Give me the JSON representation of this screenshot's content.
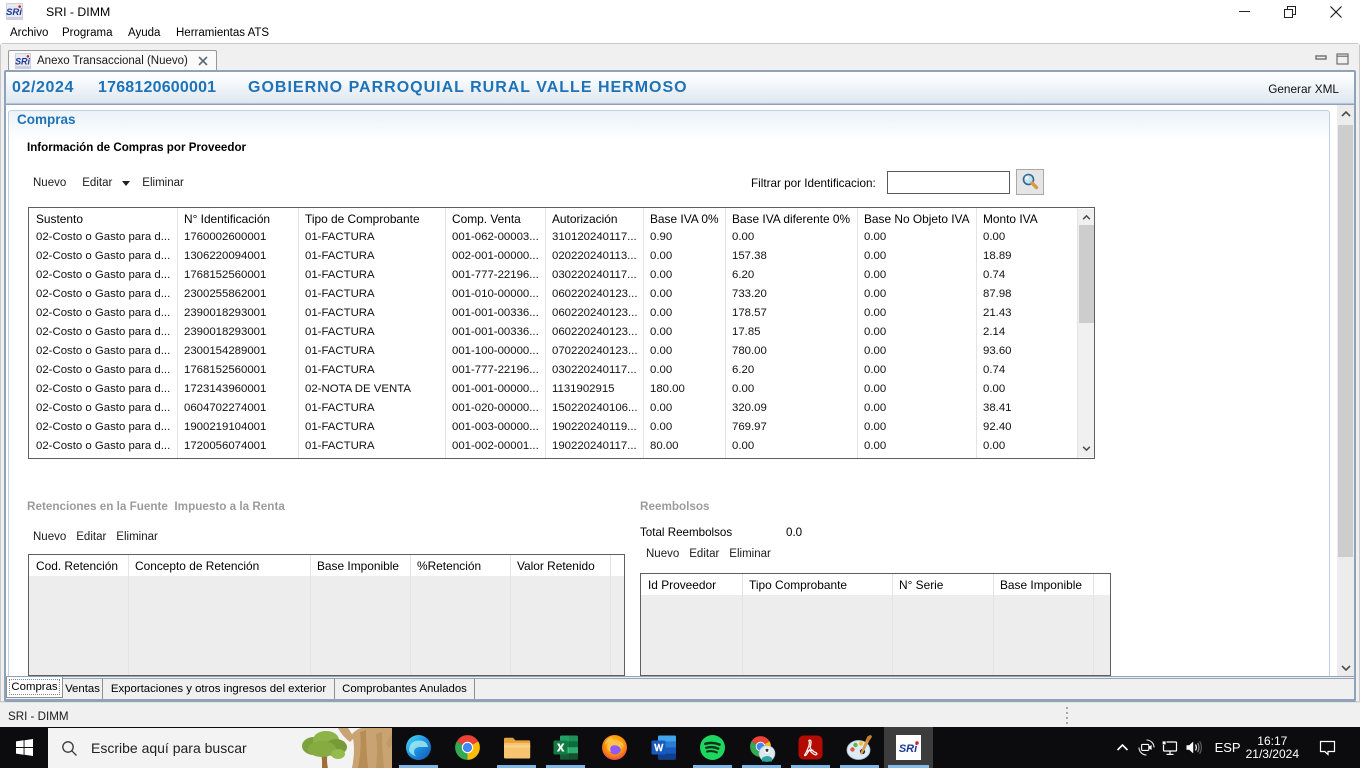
{
  "window": {
    "title": "SRI - DIMM",
    "controls": {
      "minimize": "minimize",
      "restore": "restore",
      "close": "close"
    }
  },
  "menu": {
    "items": [
      "Archivo",
      "Programa",
      "Ayuda",
      "Herramientas ATS"
    ]
  },
  "editor_tab": {
    "label": "Anexo Transaccional (Nuevo)",
    "icon": "sri-logo-icon",
    "close_icon": "close-tab-icon"
  },
  "doc_header": {
    "period": "02/2024",
    "ruc": "1768120600001",
    "taxpayer": "GOBIERNO PARROQUIAL RURAL VALLE HERMOSO",
    "action": "Generar XML"
  },
  "section": {
    "title": "Compras"
  },
  "compras": {
    "heading": "Información de Compras por Proveedor",
    "toolbar": {
      "nuevo": "Nuevo",
      "editar": "Editar",
      "eliminar": "Eliminar"
    },
    "filter": {
      "label": "Filtrar por Identificacion:",
      "value": "",
      "button_icon": "search-magnifier-icon"
    },
    "table": {
      "headers": [
        "Sustento",
        "N° Identificación",
        "Tipo de Comprobante",
        "Comp. Venta",
        "Autorización",
        "Base IVA 0%",
        "Base IVA diferente 0%",
        "Base No Objeto IVA",
        "Monto IVA"
      ],
      "rows": [
        [
          "02-Costo o Gasto para d...",
          "1760002600001",
          "01-FACTURA",
          "001-062-00003...",
          "310120240117...",
          "0.90",
          "0.00",
          "0.00",
          "0.00"
        ],
        [
          "02-Costo o Gasto para d...",
          "1306220094001",
          "01-FACTURA",
          "002-001-00000...",
          "020220240113...",
          "0.00",
          "157.38",
          "0.00",
          "18.89"
        ],
        [
          "02-Costo o Gasto para d...",
          "1768152560001",
          "01-FACTURA",
          "001-777-22196...",
          "030220240117...",
          "0.00",
          "6.20",
          "0.00",
          "0.74"
        ],
        [
          "02-Costo o Gasto para d...",
          "2300255862001",
          "01-FACTURA",
          "001-010-00000...",
          "060220240123...",
          "0.00",
          "733.20",
          "0.00",
          "87.98"
        ],
        [
          "02-Costo o Gasto para d...",
          "2390018293001",
          "01-FACTURA",
          "001-001-00336...",
          "060220240123...",
          "0.00",
          "178.57",
          "0.00",
          "21.43"
        ],
        [
          "02-Costo o Gasto para d...",
          "2390018293001",
          "01-FACTURA",
          "001-001-00336...",
          "060220240123...",
          "0.00",
          "17.85",
          "0.00",
          "2.14"
        ],
        [
          "02-Costo o Gasto para d...",
          "2300154289001",
          "01-FACTURA",
          "001-100-00000...",
          "070220240123...",
          "0.00",
          "780.00",
          "0.00",
          "93.60"
        ],
        [
          "02-Costo o Gasto para d...",
          "1768152560001",
          "01-FACTURA",
          "001-777-22196...",
          "030220240117...",
          "0.00",
          "6.20",
          "0.00",
          "0.74"
        ],
        [
          "02-Costo o Gasto para d...",
          "1723143960001",
          "02-NOTA DE VENTA",
          "001-001-00000...",
          "1131902915",
          "180.00",
          "0.00",
          "0.00",
          "0.00"
        ],
        [
          "02-Costo o Gasto para d...",
          "0604702274001",
          "01-FACTURA",
          "001-020-00000...",
          "150220240106...",
          "0.00",
          "320.09",
          "0.00",
          "38.41"
        ],
        [
          "02-Costo o Gasto para d...",
          "1900219104001",
          "01-FACTURA",
          "001-003-00000...",
          "190220240119...",
          "0.00",
          "769.97",
          "0.00",
          "92.40"
        ],
        [
          "02-Costo o Gasto para d...",
          "1720056074001",
          "01-FACTURA",
          "001-002-00001...",
          "190220240117...",
          "80.00",
          "0.00",
          "0.00",
          "0.00"
        ]
      ]
    }
  },
  "retenciones": {
    "title": "Retenciones en la Fuente  Impuesto a la Renta",
    "toolbar": {
      "nuevo": "Nuevo",
      "editar": "Editar",
      "eliminar": "Eliminar"
    },
    "table": {
      "headers": [
        "Cod. Retención",
        "Concepto de Retención",
        "Base Imponible",
        "%Retención",
        "Valor Retenido"
      ],
      "rows": []
    }
  },
  "reembolsos": {
    "title": "Reembolsos",
    "total_label": "Total Reembolsos",
    "total_value": "0.0",
    "toolbar": {
      "nuevo": "Nuevo",
      "editar": "Editar",
      "eliminar": "Eliminar"
    },
    "table": {
      "headers": [
        "Id Proveedor",
        "Tipo Comprobante",
        "N° Serie",
        "Base Imponible"
      ],
      "rows": []
    }
  },
  "bottom_tabs": {
    "items": [
      {
        "label": "Compras",
        "active": true
      },
      {
        "label": "Ventas",
        "active": false
      },
      {
        "label": "Exportaciones y otros ingresos del exterior",
        "active": false
      },
      {
        "label": "Comprobantes Anulados",
        "active": false
      }
    ]
  },
  "statusbar": {
    "text": "SRI - DIMM"
  },
  "taskbar": {
    "start_icon": "windows-start-icon",
    "search": {
      "placeholder": "Escribe aquí para buscar",
      "icon": "search-icon",
      "art": "tree-artwork"
    },
    "apps": [
      {
        "id": "edge",
        "icon": "edge-icon",
        "running": true,
        "active": false
      },
      {
        "id": "chrome",
        "icon": "chrome-icon",
        "running": false,
        "active": false
      },
      {
        "id": "explorer",
        "icon": "file-explorer-icon",
        "running": true,
        "active": false
      },
      {
        "id": "excel",
        "icon": "excel-icon",
        "running": true,
        "active": false
      },
      {
        "id": "firefox",
        "icon": "firefox-icon",
        "running": false,
        "active": false
      },
      {
        "id": "word",
        "icon": "word-icon",
        "running": false,
        "active": false
      },
      {
        "id": "spotify",
        "icon": "spotify-icon",
        "running": true,
        "active": false
      },
      {
        "id": "chrome-profile",
        "icon": "chrome-profile-icon",
        "running": true,
        "active": false
      },
      {
        "id": "acrobat",
        "icon": "acrobat-icon",
        "running": true,
        "active": false
      },
      {
        "id": "paint",
        "icon": "paint-icon",
        "running": true,
        "active": false
      },
      {
        "id": "sri-dimm",
        "icon": "sri-icon",
        "running": true,
        "active": true
      }
    ],
    "tray": {
      "chevron_icon": "chevron-up-icon",
      "meet_icon": "camera-icon",
      "network_icon": "network-icon",
      "volume_icon": "speaker-icon",
      "language": "ESP",
      "time": "16:17",
      "date": "21/3/2024",
      "notification_icon": "action-center-icon"
    }
  }
}
